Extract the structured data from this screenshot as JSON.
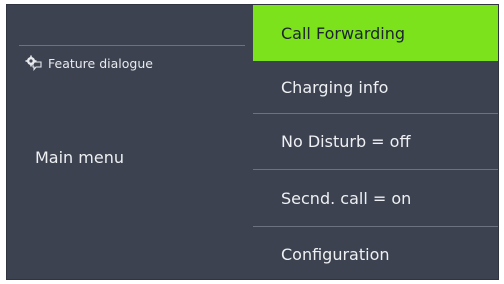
{
  "left_panel": {
    "feature_label": "Feature dialogue",
    "main_menu_label": "Main menu"
  },
  "menu": {
    "items": [
      {
        "label": "Call Forwarding",
        "selected": true
      },
      {
        "label": "Charging info",
        "selected": false
      },
      {
        "label": "No Disturb = off",
        "selected": false
      },
      {
        "label": "Secnd. call = on",
        "selected": false
      },
      {
        "label": "Configuration",
        "selected": false
      }
    ]
  },
  "colors": {
    "display_background": "#3c4250",
    "highlight": "#7be21b",
    "text": "#eef0f3"
  },
  "icons": {
    "feature": "feature-dialogue-icon"
  }
}
